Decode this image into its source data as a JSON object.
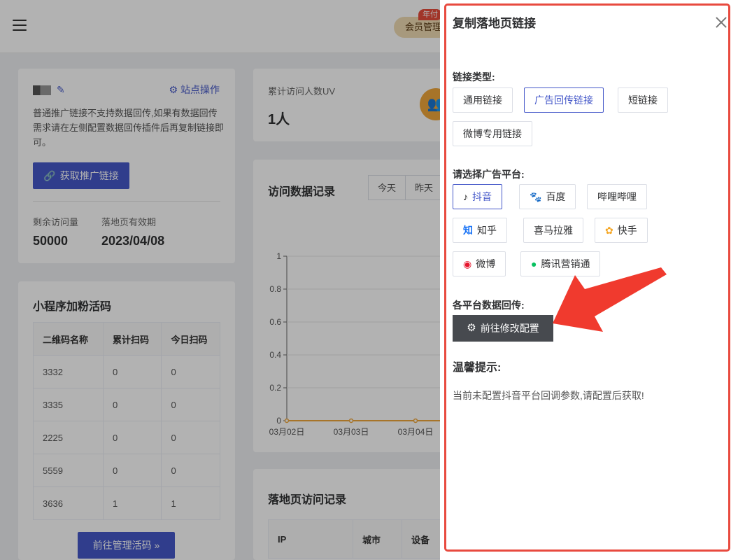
{
  "header": {
    "vip_label": "会员管理",
    "vip_tag": "年付"
  },
  "site_card": {
    "operation_label": "站点操作",
    "description": "普通推广链接不支持数据回传,如果有数据回传需求请在左侧配置数据回传插件后再复制链接即可。",
    "get_link_label": "获取推广链接",
    "remaining_label": "剩余访问量",
    "remaining_value": "50000",
    "expiry_label": "落地页有效期",
    "expiry_value": "2023/04/08"
  },
  "qr_card": {
    "title": "小程序加粉活码",
    "columns": [
      "二维码名称",
      "累计扫码",
      "今日扫码"
    ],
    "rows": [
      [
        "3332",
        "0",
        "0"
      ],
      [
        "3335",
        "0",
        "0"
      ],
      [
        "2225",
        "0",
        "0"
      ],
      [
        "5559",
        "0",
        "0"
      ],
      [
        "3636",
        "1",
        "1"
      ]
    ],
    "manage_label": "前往管理活码 »"
  },
  "uv_card": {
    "label": "累计访问人数UV",
    "value": "1人"
  },
  "visit_card": {
    "title": "访问数据记录",
    "tabs": [
      "今天",
      "昨天"
    ]
  },
  "chart_data": {
    "type": "line",
    "x": [
      "03月02日",
      "03月03日",
      "03月04日"
    ],
    "series": [
      {
        "values": [
          0,
          0,
          0
        ]
      }
    ],
    "ylim": [
      0,
      1
    ],
    "yticks": [
      "0",
      "0.2",
      "0.4",
      "0.6",
      "0.8",
      "1"
    ],
    "grid": true,
    "color": "#f0a73c"
  },
  "lp_card": {
    "title": "落地页访问记录",
    "columns": [
      "IP",
      "城市",
      "设备"
    ]
  },
  "drawer": {
    "title": "复制落地页链接",
    "link_type_label": "链接类型:",
    "link_types": [
      "通用链接",
      "广告回传链接",
      "短链接",
      "微博专用链接"
    ],
    "selected_link_type": "广告回传链接",
    "platform_label": "请选择广告平台:",
    "platforms": [
      "抖音",
      "百度",
      "哔哩哔哩",
      "知乎",
      "喜马拉雅",
      "快手",
      "微博",
      "腾讯营销通"
    ],
    "selected_platform": "抖音",
    "callback_label": "各平台数据回传:",
    "config_button": "前往修改配置",
    "tip_title": "温馨提示:",
    "tip_text": "当前未配置抖音平台回调参数,请配置后获取!"
  },
  "colors": {
    "primary": "#4558c9",
    "highlight_outline": "#e84a3f",
    "arrow": "#f03a2e",
    "config_button": "#474a4f"
  }
}
